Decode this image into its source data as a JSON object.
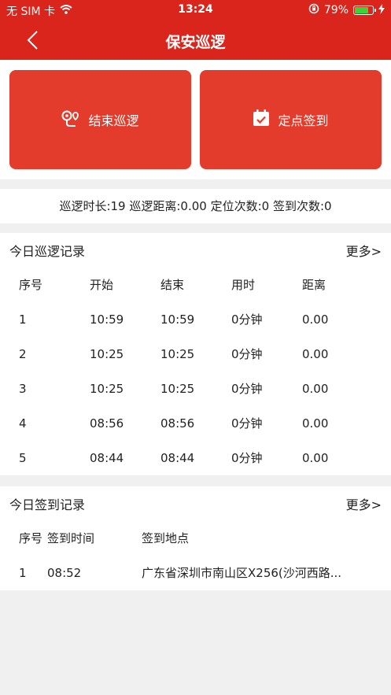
{
  "status": {
    "carrier": "无 SIM 卡",
    "time": "13:24",
    "battery_pct": "79%",
    "battery_level": 0.79
  },
  "nav": {
    "title": "保安巡逻"
  },
  "actions": {
    "end_patrol": "结束巡逻",
    "checkin": "定点签到"
  },
  "stats": {
    "text": "巡逻时长:19 巡逻距离:0.00 定位次数:0 签到次数:0"
  },
  "patrol": {
    "title": "今日巡逻记录",
    "more": "更多>",
    "headers": [
      "序号",
      "开始",
      "结束",
      "用时",
      "距离"
    ],
    "rows": [
      [
        "1",
        "10:59",
        "10:59",
        "0分钟",
        "0.00"
      ],
      [
        "2",
        "10:25",
        "10:25",
        "0分钟",
        "0.00"
      ],
      [
        "3",
        "10:25",
        "10:25",
        "0分钟",
        "0.00"
      ],
      [
        "4",
        "08:56",
        "08:56",
        "0分钟",
        "0.00"
      ],
      [
        "5",
        "08:44",
        "08:44",
        "0分钟",
        "0.00"
      ]
    ]
  },
  "checkin": {
    "title": "今日签到记录",
    "more": "更多>",
    "headers": [
      "序号",
      "签到时间",
      "签到地点"
    ],
    "rows": [
      [
        "1",
        "08:52",
        "广东省深圳市南山区X256(沙河西路..."
      ]
    ]
  },
  "colors": {
    "brand_red": "#da251c",
    "button_red": "#e43c2c",
    "battery_green": "#3fd13a"
  },
  "icons": [
    "wifi-icon",
    "rotation-lock-icon",
    "battery-icon",
    "charging-bolt-icon",
    "back-chevron-icon",
    "route-pin-icon",
    "calendar-check-icon"
  ]
}
